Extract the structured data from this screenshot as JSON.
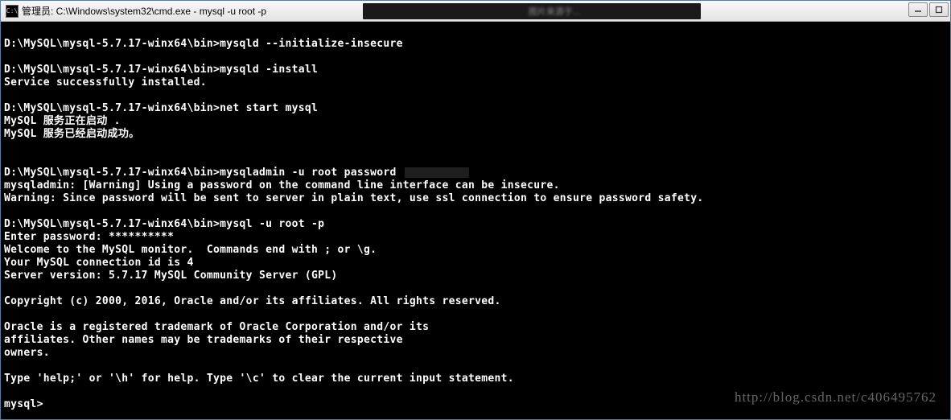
{
  "titlebar": {
    "icon_label": "C:\\",
    "title": "管理员: C:\\Windows\\system32\\cmd.exe - mysql  -u root -p",
    "blur_text": "图片来源于..."
  },
  "window_controls": {
    "minimize": "minimize",
    "maximize": "maximize"
  },
  "terminal": {
    "lines": [
      "",
      "D:\\MySQL\\mysql-5.7.17-winx64\\bin>mysqld --initialize-insecure",
      "",
      "D:\\MySQL\\mysql-5.7.17-winx64\\bin>mysqld -install",
      "Service successfully installed.",
      "",
      "D:\\MySQL\\mysql-5.7.17-winx64\\bin>net start mysql",
      "MySQL 服务正在启动 .",
      "MySQL 服务已经启动成功。",
      "",
      "",
      "D:\\MySQL\\mysql-5.7.17-winx64\\bin>mysqladmin -u root password ",
      "mysqladmin: [Warning] Using a password on the command line interface can be insecure.",
      "Warning: Since password will be sent to server in plain text, use ssl connection to ensure password safety.",
      "",
      "D:\\MySQL\\mysql-5.7.17-winx64\\bin>mysql -u root -p",
      "Enter password: **********",
      "Welcome to the MySQL monitor.  Commands end with ; or \\g.",
      "Your MySQL connection id is 4",
      "Server version: 5.7.17 MySQL Community Server (GPL)",
      "",
      "Copyright (c) 2000, 2016, Oracle and/or its affiliates. All rights reserved.",
      "",
      "Oracle is a registered trademark of Oracle Corporation and/or its",
      "affiliates. Other names may be trademarks of their respective",
      "owners.",
      "",
      "Type 'help;' or '\\h' for help. Type '\\c' to clear the current input statement.",
      "",
      "mysql>"
    ],
    "redacted_line_index": 11
  },
  "watermark": "http://blog.csdn.net/c406495762"
}
